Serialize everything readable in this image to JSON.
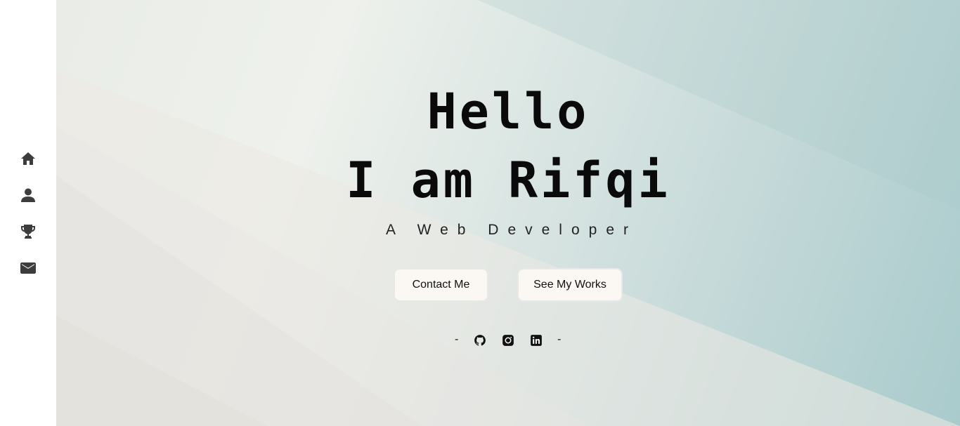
{
  "sidebar": {
    "items": [
      {
        "icon": "home-icon"
      },
      {
        "icon": "user-icon"
      },
      {
        "icon": "trophy-icon"
      },
      {
        "icon": "mail-icon"
      }
    ]
  },
  "hero": {
    "title_line1": "Hello",
    "title_line2": "I am Rifqi",
    "subtitle": "A Web Developer",
    "buttons": {
      "contact_label": "Contact Me",
      "works_label": "See My Works"
    },
    "social": {
      "separator_left": "-",
      "separator_right": "-",
      "icons": [
        "github-icon",
        "instagram-icon",
        "linkedin-icon"
      ]
    }
  },
  "colors": {
    "text": "#0a0a0a",
    "icon": "#3d3d3d",
    "button_bg": "#fbf8f4",
    "bg_left": "#e9ece7",
    "bg_right": "#a9cbcc"
  }
}
